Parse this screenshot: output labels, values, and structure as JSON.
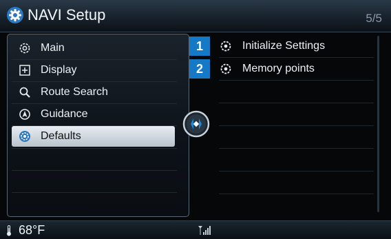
{
  "header": {
    "title": "NAVI Setup",
    "page": "5/5",
    "icon": "gear-icon"
  },
  "menu": {
    "items": [
      {
        "label": "Main",
        "icon": "gear-icon",
        "selected": false
      },
      {
        "label": "Display",
        "icon": "display-icon",
        "selected": false
      },
      {
        "label": "Route Search",
        "icon": "search-icon",
        "selected": false
      },
      {
        "label": "Guidance",
        "icon": "compass-icon",
        "selected": false
      },
      {
        "label": "Defaults",
        "icon": "gear-icon",
        "selected": true
      }
    ]
  },
  "options": {
    "items": [
      {
        "number": "1",
        "label": "Initialize Settings",
        "icon": "reset-gear-icon"
      },
      {
        "number": "2",
        "label": "Memory points",
        "icon": "reset-gear-icon"
      }
    ]
  },
  "status": {
    "temperature": "68°F",
    "icons": [
      "thermometer-icon",
      "signal-icon"
    ]
  },
  "colors": {
    "accent": "#1579c6",
    "selected_bg": "#d6dde3",
    "title_bar": "#1f2b36"
  }
}
